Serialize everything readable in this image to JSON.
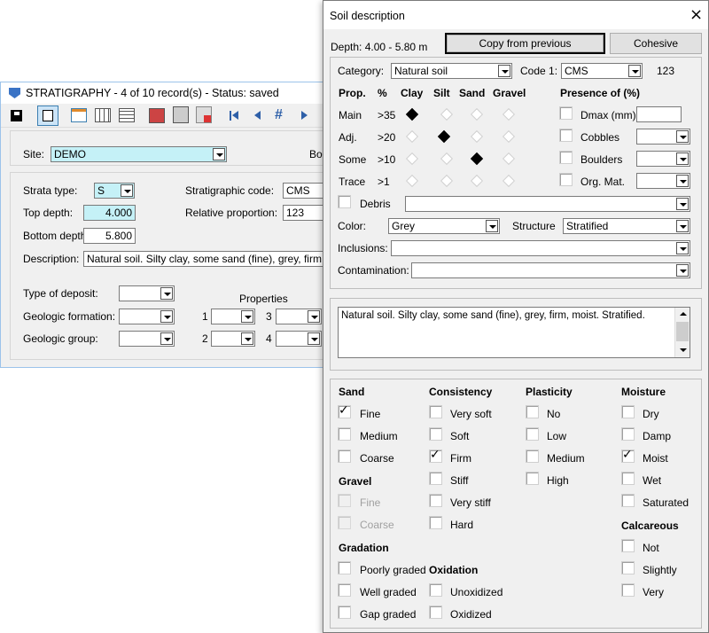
{
  "strat": {
    "title": "STRATIGRAPHY - 4 of 10 record(s) - Status: saved",
    "site_label": "Site:",
    "site_value": "DEMO",
    "bor_label": "Bor",
    "strata_type_label": "Strata type:",
    "strata_type_value": "S",
    "strat_code_label": "Stratigraphic code:",
    "strat_code_value": "CMS",
    "top_depth_label": "Top depth:",
    "top_depth_value": "4.000",
    "rel_prop_label": "Relative proportion:",
    "rel_prop_value": "123",
    "bottom_depth_label": "Bottom depth:",
    "bottom_depth_value": "5.800",
    "description_label": "Description:",
    "description_value": "Natural soil. Silty clay, some sand (fine), grey, firm, moist",
    "deposit_label": "Type of deposit:",
    "geo_formation_label": "Geologic formation:",
    "geo_group_label": "Geologic group:",
    "properties_label": "Properties",
    "prop1": "1",
    "prop2": "2",
    "prop3": "3",
    "prop4": "4"
  },
  "dialog": {
    "title": "Soil description",
    "close": "×",
    "depth_label": "Depth: 4.00 - 5.80 m",
    "copy_button": "Copy from previous",
    "cohesive_button": "Cohesive",
    "category_label": "Category:",
    "category_value": "Natural soil",
    "code1_label": "Code 1:",
    "code1_value": "CMS",
    "code1_number": "123",
    "prop_header": "Prop.",
    "pct_header": "%",
    "clay_header": "Clay",
    "silt_header": "Silt",
    "sand_header": "Sand",
    "gravel_header": "Gravel",
    "presence_header": "Presence of (%)",
    "rows": [
      {
        "label": "Main",
        "pct": ">35"
      },
      {
        "label": "Adj.",
        "pct": ">20"
      },
      {
        "label": "Some",
        "pct": ">10"
      },
      {
        "label": "Trace",
        "pct": ">1"
      }
    ],
    "dmax": "Dmax (mm)",
    "cobbles": "Cobbles",
    "boulders": "Boulders",
    "org_mat": "Org. Mat.",
    "debris": "Debris",
    "color_label": "Color:",
    "color_value": "Grey",
    "structure_label": "Structure",
    "structure_value": "Stratified",
    "inclusions_label": "Inclusions:",
    "contamination_label": "Contamination:",
    "description_text": "Natural soil. Silty clay, some sand (fine), grey, firm, moist. Stratified.",
    "sand_h": "Sand",
    "fine": "Fine",
    "medium": "Medium",
    "coarse": "Coarse",
    "gravel_h": "Gravel",
    "g_fine": "Fine",
    "g_coarse": "Coarse",
    "gradation_h": "Gradation",
    "poorly": "Poorly graded",
    "well": "Well graded",
    "gap": "Gap graded",
    "consistency_h": "Consistency",
    "very_soft": "Very soft",
    "soft": "Soft",
    "firm": "Firm",
    "stiff": "Stiff",
    "very_stiff": "Very stiff",
    "hard": "Hard",
    "oxidation_h": "Oxidation",
    "unoxidized": "Unoxidized",
    "oxidized": "Oxidized",
    "plasticity_h": "Plasticity",
    "no": "No",
    "low": "Low",
    "p_medium": "Medium",
    "high": "High",
    "moisture_h": "Moisture",
    "dry": "Dry",
    "damp": "Damp",
    "moist": "Moist",
    "wet": "Wet",
    "saturated": "Saturated",
    "calcareous_h": "Calcareous",
    "not": "Not",
    "slightly": "Slightly",
    "very": "Very"
  }
}
